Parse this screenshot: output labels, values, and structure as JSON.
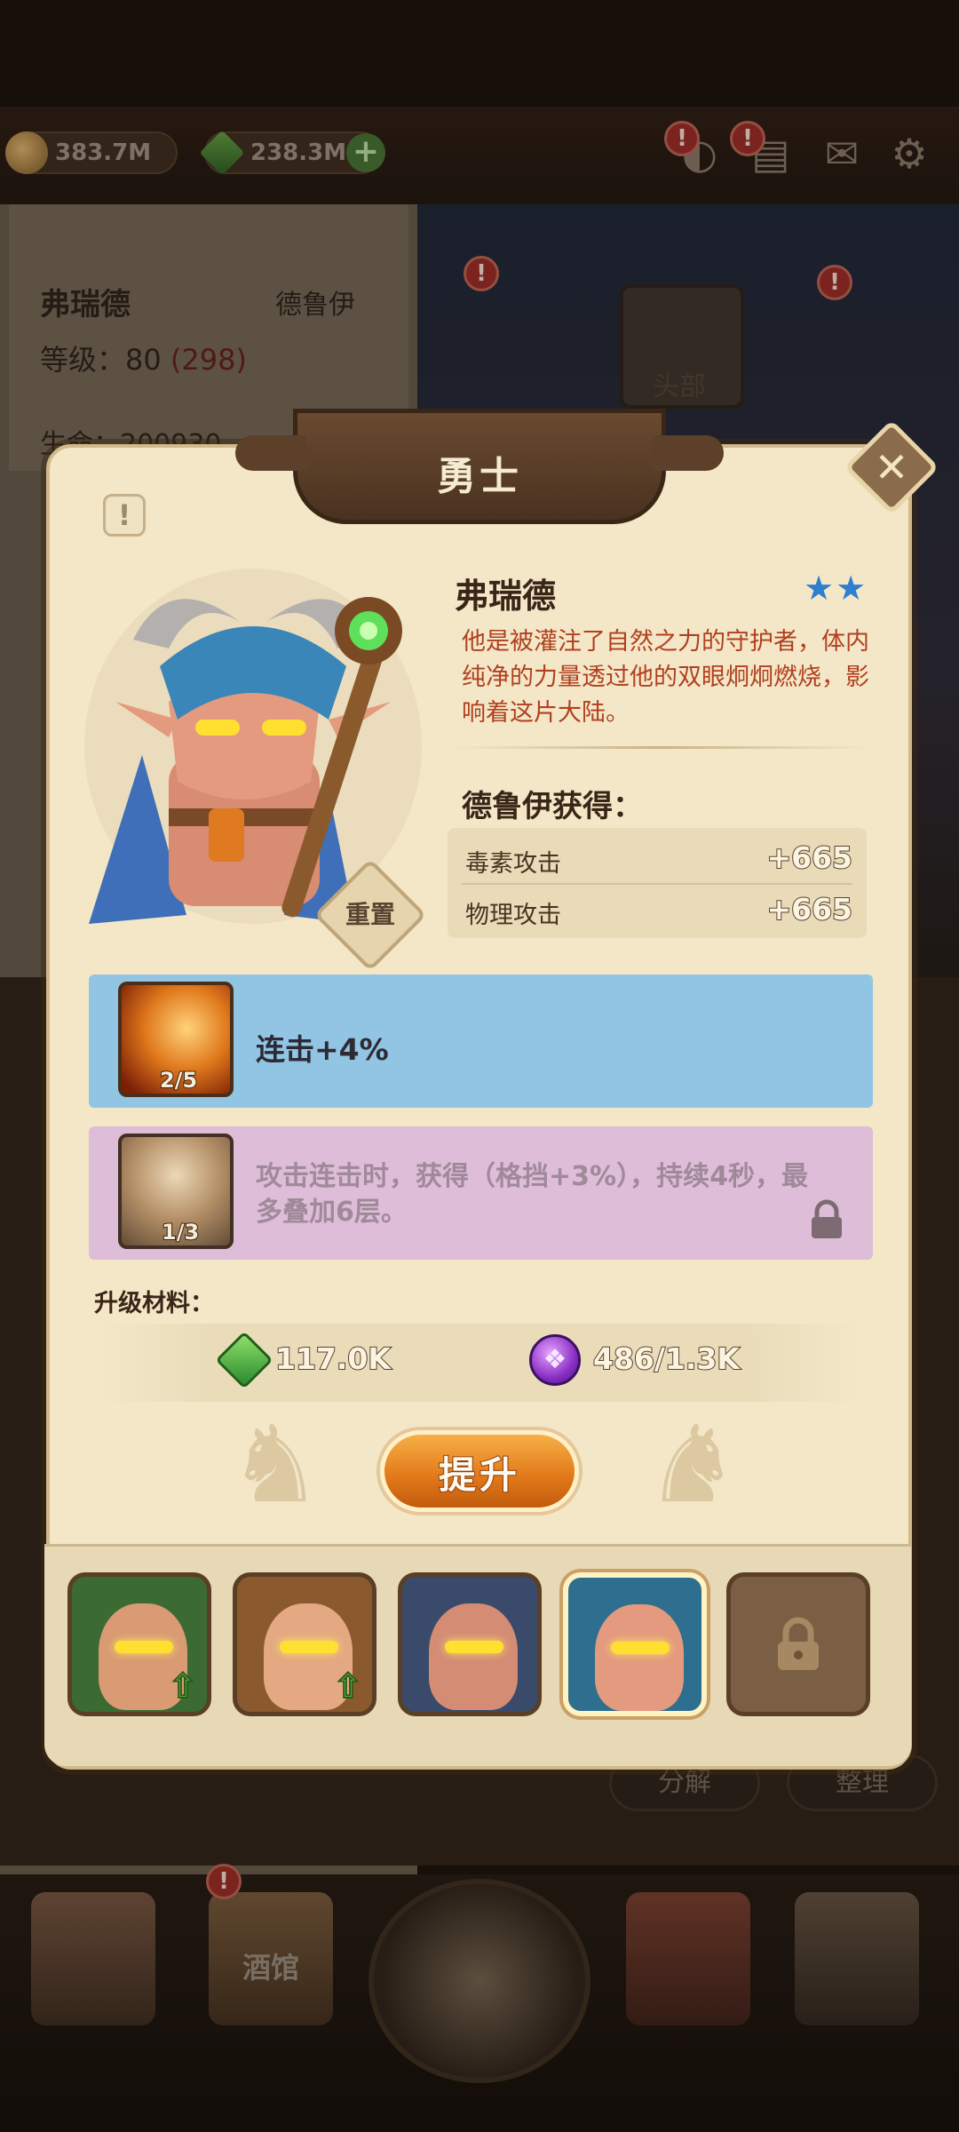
{
  "background": {
    "currency_gold": "383.7M",
    "currency_gem": "238.3M",
    "hero_name": "弗瑞德",
    "hero_class": "德鲁伊",
    "level_label": "等级：",
    "level_value": "80",
    "level_extra": "(298)",
    "life_label": "生命：200930",
    "slot_head": "头部",
    "btn_decompose": "分解",
    "btn_organize": "整理",
    "nav_tavern": "酒馆"
  },
  "modal": {
    "title": "勇士",
    "close_glyph": "✕",
    "info_glyph": "!",
    "reset_label": "重置",
    "hero": {
      "name": "弗瑞德",
      "stars": "★★",
      "description": "他是被灌注了自然之力的守护者，体内纯净的力量透过他的双眼炯炯燃烧，影响着这片大陆。"
    },
    "gain": {
      "title": "德鲁伊获得：",
      "stats": [
        {
          "label": "毒素攻击",
          "value": "+665"
        },
        {
          "label": "物理攻击",
          "value": "+665"
        }
      ]
    },
    "talents": [
      {
        "level": "2/5",
        "text": "连击+4%",
        "locked": false
      },
      {
        "level": "1/3",
        "text": "攻击连击时，获得（格挡+3%），持续4秒，最多叠加6层。",
        "locked": true
      }
    ],
    "materials": {
      "title": "升级材料：",
      "gem_amount": "117.0K",
      "paw_amount": "486/1.3K"
    },
    "upgrade_label": "提升"
  },
  "colors": {
    "accent_orange": "#e07718",
    "talent_blue": "#92c5e3",
    "talent_purple": "#ddbdd8",
    "star_blue": "#2f7fd0",
    "desc_red": "#b0401f"
  }
}
